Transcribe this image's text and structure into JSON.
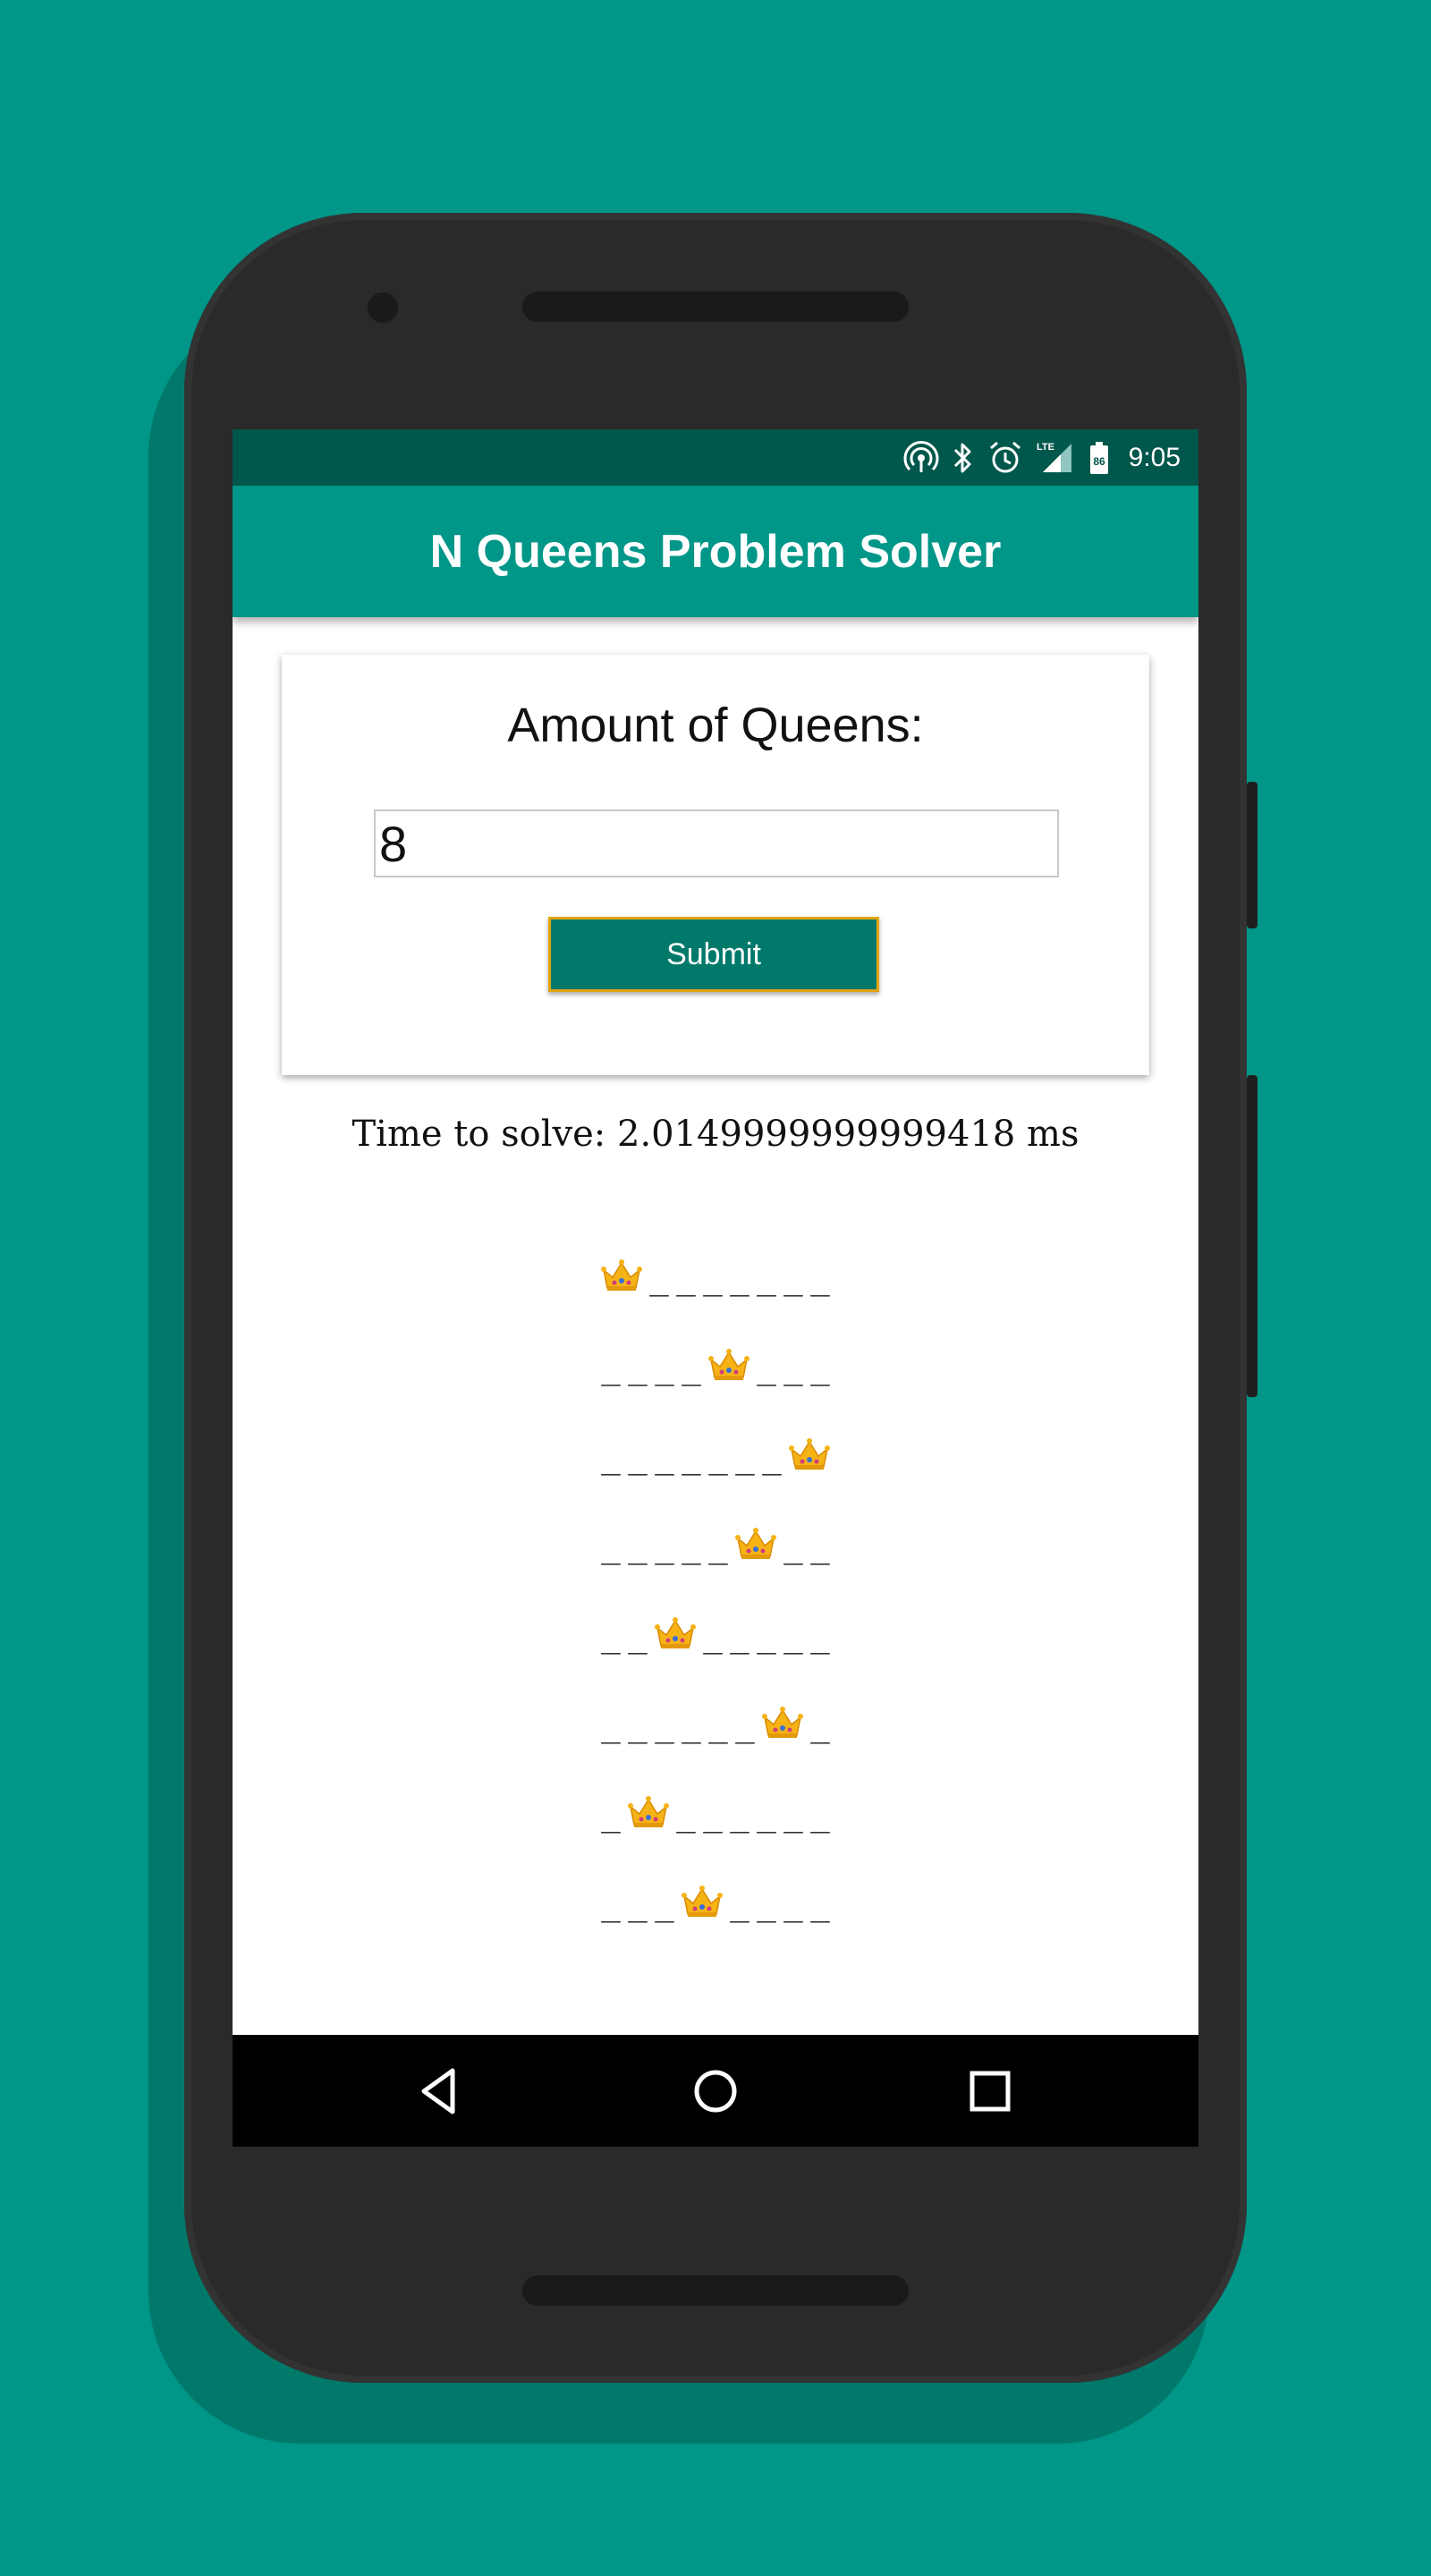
{
  "status_bar": {
    "time": "9:05",
    "network": "LTE",
    "battery": "86",
    "icons": [
      "hotspot-icon",
      "bluetooth-icon",
      "alarm-icon",
      "signal-icon",
      "battery-icon"
    ]
  },
  "app_bar": {
    "title": "N Queens Problem Solver"
  },
  "form": {
    "heading": "Amount of Queens:",
    "queens_value": "8",
    "submit_label": "Submit"
  },
  "result": {
    "time_text": "Time to solve: 2.0149999999999418 ms",
    "queen_columns": [
      0,
      4,
      7,
      5,
      2,
      6,
      1,
      3
    ],
    "empty_glyph": "_"
  },
  "nav_bar": {
    "buttons": [
      "back",
      "home",
      "recents"
    ]
  },
  "colors": {
    "background": "#009688",
    "status_bar": "#00574B",
    "app_bar": "#009688",
    "button": "#00796B",
    "button_border": "#E0A40F"
  }
}
